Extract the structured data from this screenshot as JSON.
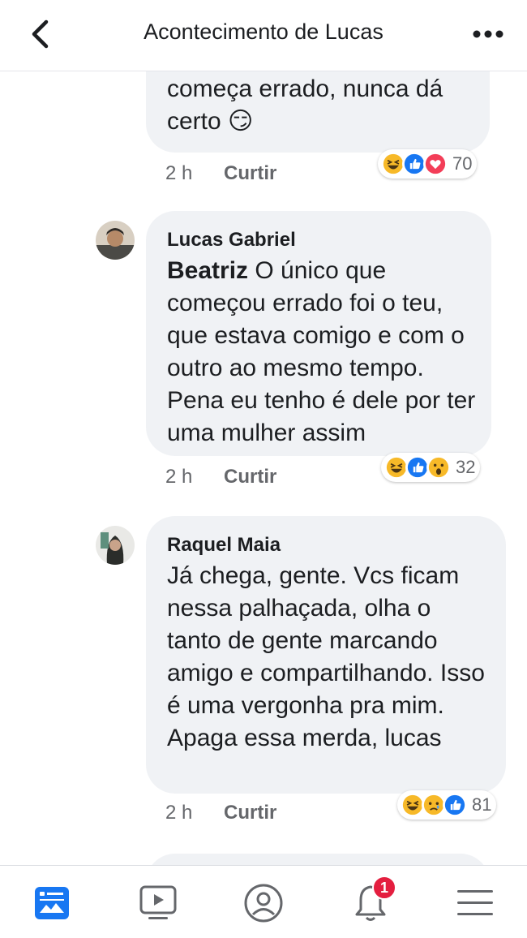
{
  "header": {
    "title": "Acontecimento de Lucas",
    "back_icon": "chevron-left-icon",
    "more_icon": "more-horizontal-icon"
  },
  "comments": [
    {
      "text_lines": [
        "começa errado, nunca dá",
        "certo 😏"
      ],
      "time": "2 h",
      "like_label": "Curtir",
      "reactions": [
        "haha",
        "like",
        "love"
      ],
      "reaction_count": "70"
    },
    {
      "author": "Lucas Gabriel",
      "mention": "Beatriz",
      "text": " O único que começou errado foi o teu, que estava comigo e com o outro ao mesmo tempo. Pena eu tenho é dele por ter uma mulher assim",
      "time": "2 h",
      "like_label": "Curtir",
      "reactions": [
        "haha",
        "like",
        "wow"
      ],
      "reaction_count": "32"
    },
    {
      "author": "Raquel Maia",
      "text": "Já chega, gente. Vcs ficam nessa palhaçada, olha o tanto de gente  marcando amigo e compartilhando. Isso é uma vergonha pra mim. Apaga essa merda, lucas",
      "time": "2 h",
      "like_label": "Curtir",
      "reactions": [
        "haha",
        "sad",
        "like"
      ],
      "reaction_count": "81"
    }
  ],
  "tabbar": {
    "tabs": [
      "news-feed-icon",
      "watch-icon",
      "profile-icon",
      "notifications-icon",
      "menu-icon"
    ],
    "notifications_badge": "1"
  },
  "colors": {
    "accent": "#1877f2",
    "bubble": "#f0f2f5",
    "badge": "#e41e3f",
    "secondary_text": "#65676b"
  }
}
